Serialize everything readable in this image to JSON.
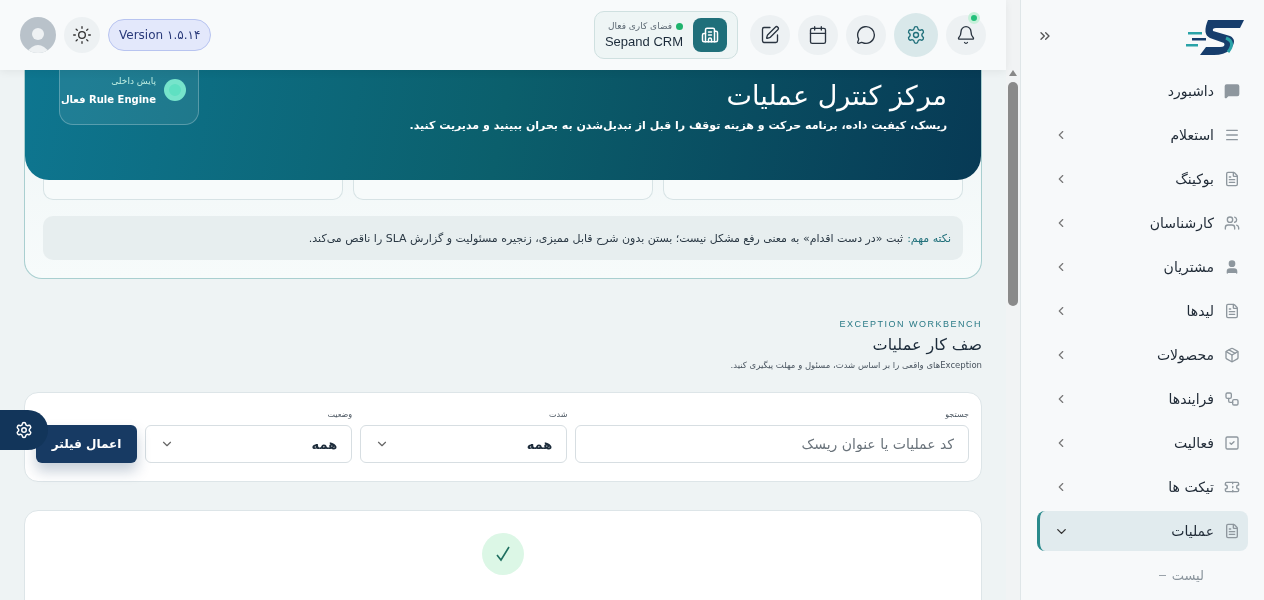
{
  "header": {
    "toolbar": [
      {
        "kind": "bell",
        "alert": true,
        "selected": false
      },
      {
        "kind": "settings",
        "selected": true
      },
      {
        "kind": "chat",
        "selected": false
      },
      {
        "kind": "calendar",
        "selected": false
      },
      {
        "kind": "edit",
        "selected": false
      }
    ],
    "workspace": {
      "label": "فضای کاری فعال",
      "name": "Sepand CRM",
      "active": true
    },
    "version": "Version ۱.۵.۱۴"
  },
  "hero": {
    "title": "مرکز کنترل عملیات",
    "subtitle": "ریسک، کیفیت داده، برنامه حرکت و هزینه توقف را قبل از تبدیل‌شدن به بحران ببینید و مدیریت کنید.",
    "status": {
      "label": "پایش داخلی",
      "value": "Rule Engine فعال",
      "active": true
    }
  },
  "note": {
    "label": "نکته مهم:",
    "text": "ثبت «در دست اقدام» به معنی رفع مشکل نیست؛ بستن بدون شرح قابل ممیزی، زنجیره مسئولیت و گزارش SLA را ناقص می‌کند."
  },
  "section": {
    "eyebrow": "EXCEPTION WORKBENCH",
    "title": "صف کار عملیات",
    "description": "Exceptionهای واقعی را بر اساس شدت، مسئول و مهلت پیگیری کنید."
  },
  "filters": [
    {
      "kind": "text",
      "label": "جستجو",
      "placeholder": "کد عملیات یا عنوان ریسک"
    },
    {
      "kind": "select",
      "label": "شدت",
      "value": "همه"
    },
    {
      "kind": "select",
      "label": "وضعیت",
      "value": "همه"
    }
  ],
  "apply_button": "اعمال فیلتر",
  "sidebar": {
    "items": [
      {
        "kind": "dashboard",
        "label": "داشبورد",
        "expandable": false,
        "selected": false
      },
      {
        "kind": "lines",
        "label": "استعلام",
        "expandable": true,
        "expanded": false,
        "selected": false
      },
      {
        "kind": "doc",
        "label": "بوکینگ",
        "expandable": true,
        "expanded": false,
        "selected": false
      },
      {
        "kind": "users",
        "label": "کارشناسان",
        "expandable": true,
        "expanded": false,
        "selected": false
      },
      {
        "kind": "user",
        "label": "مشتریان",
        "expandable": true,
        "expanded": false,
        "selected": false
      },
      {
        "kind": "doc",
        "label": "لیدها",
        "expandable": true,
        "expanded": false,
        "selected": false
      },
      {
        "kind": "box",
        "label": "محصولات",
        "expandable": true,
        "expanded": false,
        "selected": false
      },
      {
        "kind": "flow",
        "label": "فرایندها",
        "expandable": true,
        "expanded": false,
        "selected": false
      },
      {
        "kind": "check",
        "label": "فعالیت",
        "expandable": true,
        "expanded": false,
        "selected": false
      },
      {
        "kind": "ticket",
        "label": "تیکت ها",
        "expandable": true,
        "expanded": false,
        "selected": false
      },
      {
        "kind": "doc",
        "label": "عملیات",
        "expandable": true,
        "expanded": true,
        "selected": true,
        "children": [
          {
            "label": "لیست"
          }
        ]
      }
    ]
  }
}
